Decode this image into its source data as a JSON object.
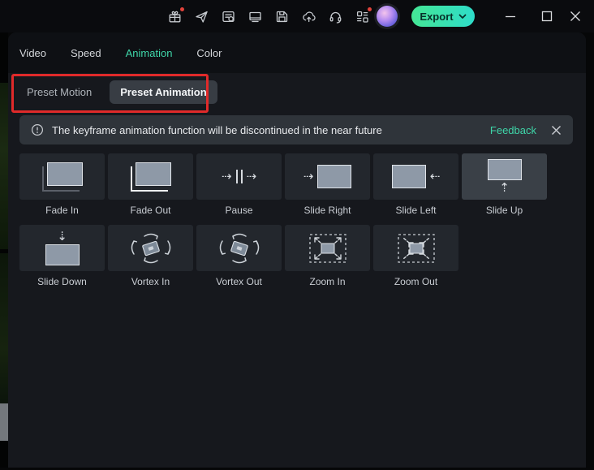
{
  "colors": {
    "accent_teal": "#3fd6a9",
    "annotation_red": "#e02a2a",
    "export_gradient_start": "#45e695",
    "export_gradient_end": "#2edcc9"
  },
  "titlebar": {
    "icons": [
      {
        "name": "gift-icon",
        "dot": true
      },
      {
        "name": "send-icon",
        "dot": false
      },
      {
        "name": "project-notes-icon",
        "dot": false
      },
      {
        "name": "display-icon",
        "dot": false
      },
      {
        "name": "save-icon",
        "dot": false
      },
      {
        "name": "cloud-upload-icon",
        "dot": false
      },
      {
        "name": "headset-support-icon",
        "dot": false
      },
      {
        "name": "apps-grid-icon",
        "dot": true
      }
    ],
    "export_button": {
      "label": "Export"
    }
  },
  "tabs": {
    "items": [
      {
        "label": "Video",
        "active": false
      },
      {
        "label": "Speed",
        "active": false
      },
      {
        "label": "Animation",
        "active": true
      },
      {
        "label": "Color",
        "active": false
      }
    ]
  },
  "subtabs": {
    "items": [
      {
        "label": "Preset Motion",
        "active": false
      },
      {
        "label": "Preset Animation",
        "active": true
      }
    ]
  },
  "banner": {
    "message": "The keyframe animation function will be discontinued in the near future",
    "feedback_label": "Feedback"
  },
  "presets": [
    {
      "label": "Fade In",
      "icon": "fade-in"
    },
    {
      "label": "Fade Out",
      "icon": "fade-out"
    },
    {
      "label": "Pause",
      "icon": "pause"
    },
    {
      "label": "Slide Right",
      "icon": "slide-right"
    },
    {
      "label": "Slide Left",
      "icon": "slide-left"
    },
    {
      "label": "Slide Up",
      "icon": "slide-up",
      "hover": true
    },
    {
      "label": "Slide Down",
      "icon": "slide-down"
    },
    {
      "label": "Vortex In",
      "icon": "vortex-in"
    },
    {
      "label": "Vortex Out",
      "icon": "vortex-out"
    },
    {
      "label": "Zoom In",
      "icon": "zoom-in"
    },
    {
      "label": "Zoom Out",
      "icon": "zoom-out"
    }
  ]
}
